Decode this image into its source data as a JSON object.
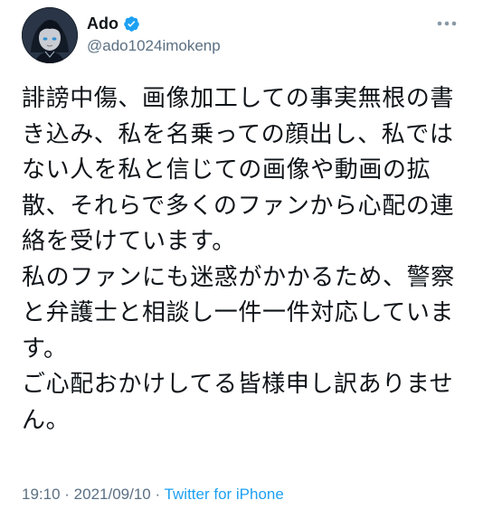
{
  "author": {
    "display_name": "Ado",
    "handle": "@ado1024imokenp",
    "verified": true
  },
  "tweet": {
    "lines": [
      "誹謗中傷、画像加工しての事実無根の書",
      "き込み、私を名乗っての顔出し、私では",
      "ない人を私と信じての画像や動画の拡",
      "散、それらで多くのファンから心配の連",
      "絡を受けています。",
      "私のファンにも迷惑がかかるため、警察",
      "と弁護士と相談し一件一件対応していま",
      "す。",
      "ご心配おかけしてる皆様申し訳ありませ",
      "ん。"
    ]
  },
  "meta": {
    "time": "19:10",
    "separator": " · ",
    "date": "2021/09/10",
    "separator2": " · ",
    "source": "Twitter for iPhone"
  },
  "icons": {
    "verified": "verified-badge-icon",
    "more": "more-options-icon"
  },
  "colors": {
    "text": "#0f1419",
    "secondary": "#5b7083",
    "accent": "#1da1f2"
  }
}
